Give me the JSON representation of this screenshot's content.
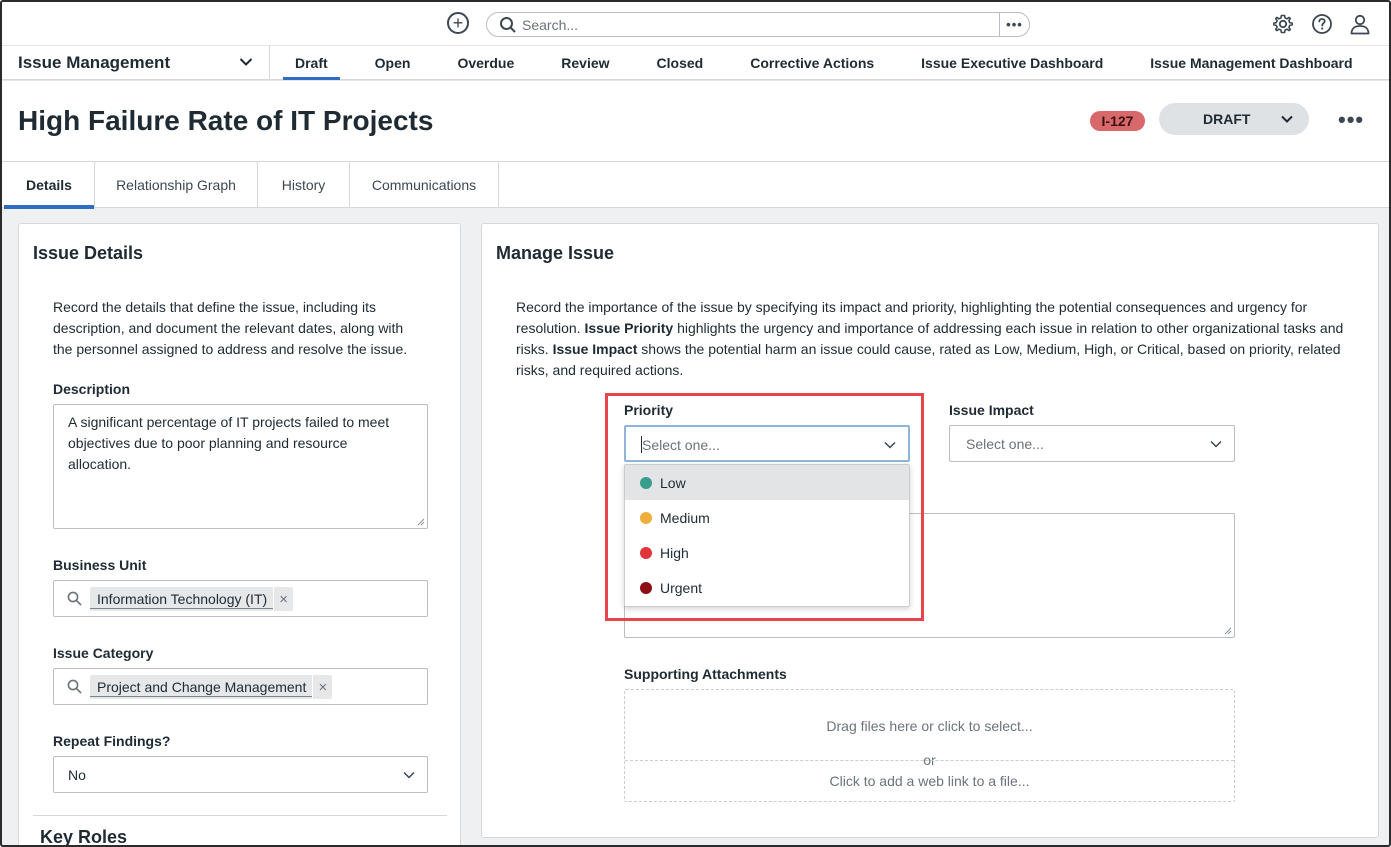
{
  "topbar": {
    "search_placeholder": "Search...",
    "more_label": "•••"
  },
  "navbar": {
    "app_name": "Issue Management",
    "tabs": [
      {
        "label": "Draft",
        "active": true
      },
      {
        "label": "Open"
      },
      {
        "label": "Overdue"
      },
      {
        "label": "Review"
      },
      {
        "label": "Closed"
      },
      {
        "label": "Corrective Actions"
      },
      {
        "label": "Issue Executive Dashboard"
      },
      {
        "label": "Issue Management Dashboard"
      }
    ]
  },
  "header": {
    "title": "High Failure Rate of IT Projects",
    "id_badge": "I-127",
    "status": "DRAFT",
    "more_label": "•••"
  },
  "tabs": [
    {
      "label": "Details",
      "active": true
    },
    {
      "label": "Relationship Graph"
    },
    {
      "label": "History"
    },
    {
      "label": "Communications"
    }
  ],
  "issue_details": {
    "heading": "Issue Details",
    "intro": "Record the details that define the issue, including its description, and document the relevant dates, along with the personnel assigned to address and resolve the issue.",
    "description_label": "Description",
    "description_value": "A significant percentage of IT projects failed to meet objectives due to poor planning and resource allocation.",
    "business_unit_label": "Business Unit",
    "business_unit_value": "Information Technology (IT)",
    "issue_category_label": "Issue Category",
    "issue_category_value": "Project and Change Management",
    "repeat_findings_label": "Repeat Findings?",
    "repeat_findings_value": "No",
    "key_roles_heading": "Key Roles"
  },
  "manage_issue": {
    "heading": "Manage Issue",
    "intro_parts": [
      "Record the importance of the issue by specifying its impact and priority, highlighting the potential consequences and urgency for resolution. ",
      "Issue Priority",
      " highlights the urgency and importance of addressing each issue in relation to other organizational tasks and risks. ",
      "Issue Impact",
      " shows the potential harm an issue could cause, rated as Low, Medium, High, or Critical, based on priority, related risks, and required actions."
    ],
    "priority_label": "Priority",
    "priority_placeholder": "Select one...",
    "impact_label": "Issue Impact",
    "impact_placeholder": "Select one...",
    "priority_options": [
      {
        "label": "Low",
        "color": "#3a9b8f"
      },
      {
        "label": "Medium",
        "color": "#f0ad3c"
      },
      {
        "label": "High",
        "color": "#e0353a"
      },
      {
        "label": "Urgent",
        "color": "#8e0e16"
      }
    ],
    "attachments_label": "Supporting Attachments",
    "drag_text": "Drag files here or click to select...",
    "or_text": "or",
    "weblink_text": "Click to add a web link to a file..."
  },
  "colors": {
    "accent": "#2f6dc2",
    "badge": "#d9686b",
    "highlight": "#e8454a"
  }
}
